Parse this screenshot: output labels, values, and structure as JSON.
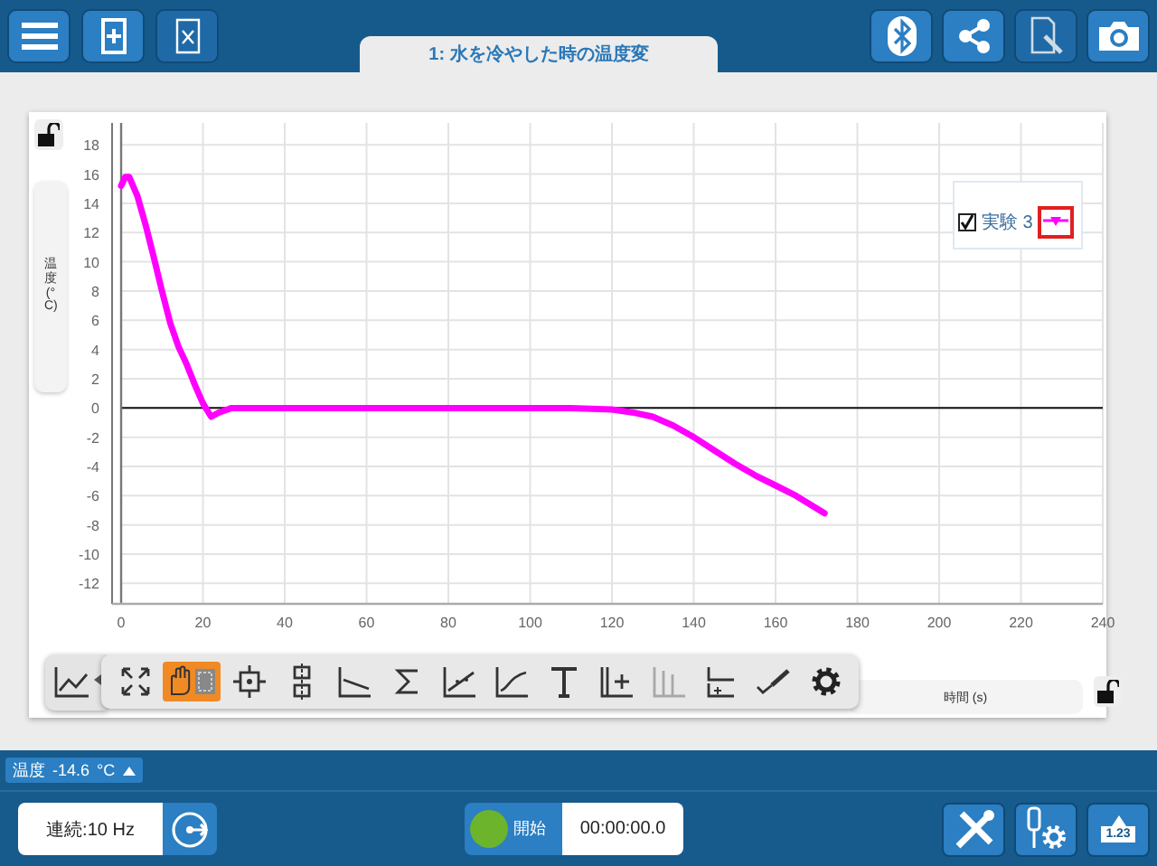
{
  "top_bar": {
    "left_buttons": [
      {
        "kind": "menu",
        "disabled": false
      },
      {
        "kind": "new-page",
        "disabled": false
      },
      {
        "kind": "spreadsheet",
        "disabled": true
      }
    ],
    "right_buttons": [
      {
        "kind": "bluetooth",
        "disabled": false
      },
      {
        "kind": "share",
        "disabled": false
      },
      {
        "kind": "annotate-page",
        "disabled": true
      },
      {
        "kind": "camera",
        "disabled": false
      }
    ]
  },
  "page_tab": {
    "title": "1: 水を冷やした時の温度変",
    "selected": true
  },
  "graph": {
    "y_locked": false,
    "x_locked": false,
    "legend_checked": true,
    "chart_data": {
      "type": "line",
      "grid": true,
      "xlabel": "時間 (s)",
      "ylabel": "温度 (°C)",
      "xlim": [
        0,
        240
      ],
      "ylim": [
        -13.4,
        19.5
      ],
      "xticks": [
        0,
        20,
        40,
        60,
        80,
        100,
        120,
        140,
        160,
        180,
        200,
        220,
        240
      ],
      "yticks": [
        -12,
        -10,
        -8,
        -6,
        -4,
        -2,
        0,
        2,
        4,
        6,
        8,
        10,
        12,
        14,
        16,
        18
      ],
      "x": [
        0,
        1,
        2,
        4,
        6,
        8,
        10,
        12,
        14,
        16,
        18,
        20,
        22,
        24,
        27,
        30,
        40,
        60,
        80,
        100,
        110,
        120,
        125,
        130,
        135,
        140,
        145,
        150,
        155,
        160,
        165,
        172
      ],
      "series": [
        {
          "name": "実験 3",
          "color": "#ff00ff",
          "values": [
            15.2,
            15.8,
            15.8,
            14.5,
            12.5,
            10.3,
            8,
            5.8,
            4.2,
            3,
            1.6,
            0.3,
            -0.6,
            -0.3,
            0,
            0,
            0,
            0,
            0,
            0,
            0,
            -0.1,
            -0.3,
            -0.6,
            -1.2,
            -2,
            -2.9,
            -3.8,
            -4.6,
            -5.3,
            -6,
            -7.2
          ]
        }
      ]
    },
    "graph_type_button": {
      "kind": "graph-type"
    },
    "toolbar": [
      {
        "kind": "autoscale",
        "selected": false,
        "disabled": false
      },
      {
        "kind": "pan-select",
        "selected": true,
        "disabled": false
      },
      {
        "kind": "examine",
        "selected": false,
        "disabled": false
      },
      {
        "kind": "examine-pair",
        "selected": false,
        "disabled": false
      },
      {
        "kind": "tangent",
        "selected": false,
        "disabled": false
      },
      {
        "kind": "integral",
        "selected": false,
        "disabled": false
      },
      {
        "kind": "linear-fit",
        "selected": false,
        "disabled": false
      },
      {
        "kind": "curve-fit",
        "selected": false,
        "disabled": false
      },
      {
        "kind": "text",
        "selected": false,
        "disabled": false
      },
      {
        "kind": "add-axis",
        "selected": false,
        "disabled": false
      },
      {
        "kind": "delta",
        "selected": false,
        "disabled": true
      },
      {
        "kind": "axes",
        "selected": false,
        "disabled": false
      },
      {
        "kind": "draw",
        "selected": false,
        "disabled": false
      },
      {
        "kind": "settings",
        "selected": false,
        "disabled": false
      }
    ]
  },
  "meter": {
    "label": "温度",
    "value": "-14.6",
    "unit": "°C"
  },
  "bottom_bar": {
    "collection_mode": "連続:10 Hz",
    "start_label": "開始",
    "timer": "00:00:00.0",
    "right_buttons": [
      {
        "kind": "tools"
      },
      {
        "kind": "sensor-settings"
      },
      {
        "kind": "meter-view",
        "label": "1.23"
      }
    ]
  }
}
